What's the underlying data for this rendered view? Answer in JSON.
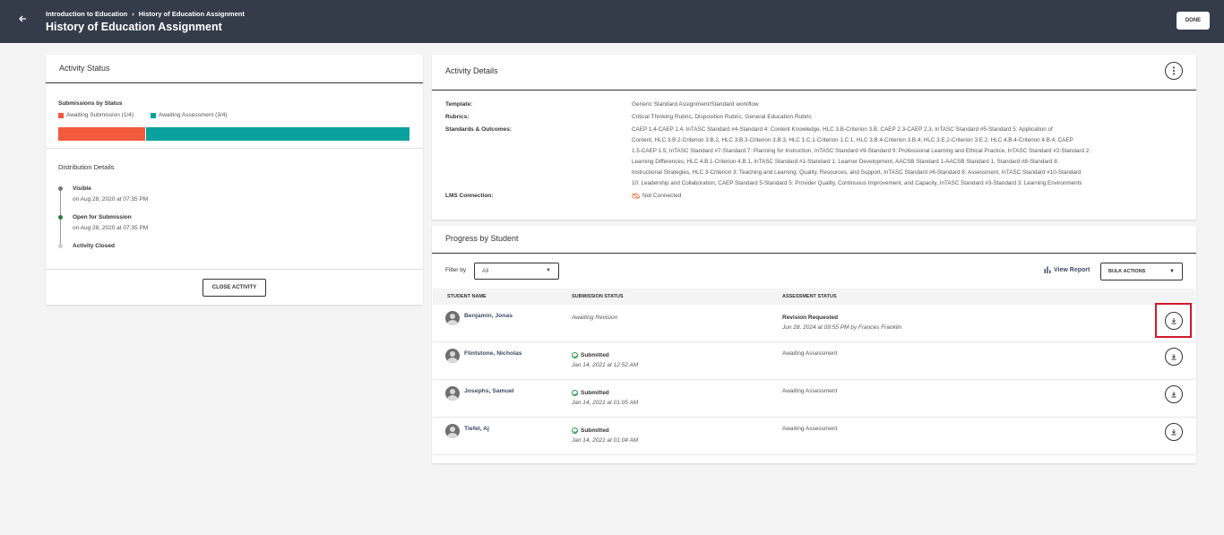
{
  "header": {
    "breadcrumb": [
      "Introduction to Education",
      "History of Education Assignment"
    ],
    "breadcrumb_separator": "›",
    "title": "History of Education Assignment",
    "done_label": "DONE",
    "back_icon": "arrow-left-icon",
    "background": "#343c4a"
  },
  "activity_status": {
    "title": "Activity Status",
    "submissions_label": "Submissions by Status",
    "legend": [
      {
        "label": "Awaiting Submission (1/4)",
        "color": "#f15a3c"
      },
      {
        "label": "Awaiting Assessment (3/4)",
        "color": "#0aa19e"
      }
    ],
    "bar": [
      {
        "fraction": 0.25,
        "color": "#f15a3c"
      },
      {
        "fraction": 0.75,
        "color": "#0aa19e"
      }
    ],
    "distribution_title": "Distribution Details",
    "timeline": [
      {
        "title": "Visible",
        "sub": "on Aug 28, 2020 at 07:35 PM",
        "dot_color": "#777777"
      },
      {
        "title": "Open for Submission",
        "sub": "on Aug 28, 2020 at 07:35 PM",
        "dot_color": "#2e7d32"
      },
      {
        "title": "Activity Closed",
        "sub": "",
        "dot_color": "#cccccc"
      }
    ],
    "close_label": "CLOSE ACTIVITY"
  },
  "activity_details": {
    "title": "Activity Details",
    "more_icon": "more-vertical-icon",
    "template_label": "Template:",
    "template_value": "Generic Standard Assignment/Standard workflow",
    "rubrics_label": "Rubrics:",
    "rubrics_value": "Critical Thinking Rubric, Disposition Rubric, General Education Rubric",
    "standards_label": "Standards & Outcomes:",
    "standards_lines": [
      "CAEP 1.4-CAEP 1.4,     InTASC Standard #4-Standard 4: Content Knowledge,     HLC 3.B-Criterion 3.B,     CAEP 2.3-CAEP 2.3,     InTASC Standard #5-Standard 5: Application of",
      "Content,     HLC 3.B.2-Criterion 3.B.2,     HLC 3.B.3-Criterion 3.B.3,     HLC 1.C.1-Criterion 1.C.1,     HLC 3.B.4-Criterion 3.B.4,     HLC 3.E.2-Criterion 3.E.2,     HLC 4.B.4-Criterion 4.B.4,     CAEP",
      "1.5-CAEP 1.5,     InTASC Standard #7-Standard 7: Planning for Instruction,     InTASC Standard #9-Standard 9: Professional Learning and Ethical Practice,     InTASC Standard #2-Standard 2:",
      "Learning Differences,     HLC 4.B.1-Criterion 4.B.1,     InTASC Standard #1-Standard 1: Learner Development,     AACSB Standard 1-AACSB Standard 1,     Standard #8-Standard 8:",
      "Instructional Strategies,     HLC 3-Criterion 3: Teaching and Learning: Quality, Resources, and Support,     InTASC Standard #6-Standard 6: Assessment,     InTASC Standard #10-Standard",
      "10: Leadership and Collaboration,     CAEP Standard 5-Standard 5: Provider Quality, Continuous Improvement, and Capacity,     InTASC Standard #3-Standard 3: Learning Environments"
    ],
    "lms_label": "LMS Connection:",
    "lms_value": "Not Connected",
    "lms_icon": "cloud-off-icon"
  },
  "progress": {
    "title": "Progress by Student",
    "filter_label": "Filter by",
    "filter_value": "All",
    "view_report_label": "View Report",
    "bulk_label": "BULK ACTIONS",
    "columns": [
      "STUDENT NAME",
      "SUBMISSION STATUS",
      "ASSESSMENT STATUS"
    ],
    "rows": [
      {
        "name": "Benjamin, Jonas",
        "submission": "Awaiting Revision",
        "submission_date": "",
        "assessment": "Revision Requested",
        "assessment_date": "Jun 28, 2024 at 09:55 PM by Frances Franklin"
      },
      {
        "name": "Flintstone, Nicholas",
        "submission": "Submitted",
        "submission_date": "Jan 14, 2021 at 12:52 AM",
        "assessment": "Awaiting Assessment",
        "assessment_date": ""
      },
      {
        "name": "Josephs, Samuel",
        "submission": "Submitted",
        "submission_date": "Jan 14, 2021 at 01:05 AM",
        "assessment": "Awaiting Assessment",
        "assessment_date": ""
      },
      {
        "name": "Tiefel, Aj",
        "submission": "Submitted",
        "submission_date": "Jan 14, 2021 at 01:04 AM",
        "assessment": "Awaiting Assessment",
        "assessment_date": ""
      }
    ],
    "download_icon": "download-icon",
    "highlight_color": "#d0192b"
  }
}
